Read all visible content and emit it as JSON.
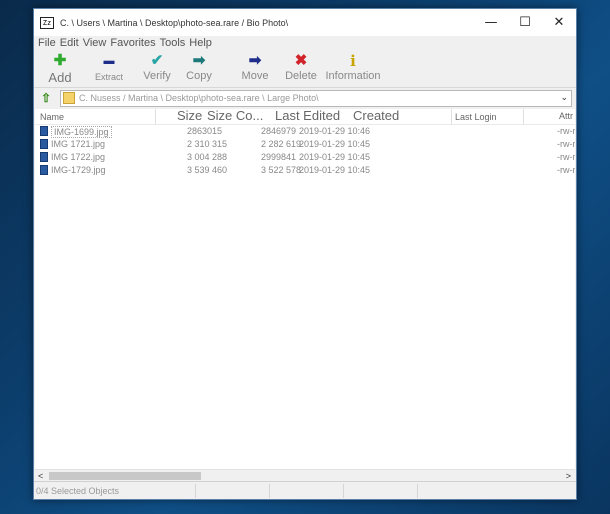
{
  "window": {
    "title": "C. \\ Users \\ Martina \\ Desktop\\photo-sea.rare / Bio Photo\\",
    "app_icon_text": "Zz",
    "controls": {
      "minimize": "—",
      "maximize": "☐",
      "close": "✕"
    }
  },
  "menu": [
    "File",
    "Edit",
    "View",
    "Favorites",
    "Tools",
    "Help"
  ],
  "toolbar": [
    {
      "label": "Add",
      "icon": "plus-icon",
      "glyph": "✚",
      "color": "#2eaa2e"
    },
    {
      "label": "Extract",
      "icon": "minus-icon",
      "glyph": "▬",
      "color": "#1f2d8a"
    },
    {
      "label": "Verify",
      "icon": "check-icon",
      "glyph": "✔",
      "color": "#2aa6a6"
    },
    {
      "label": "Copy",
      "icon": "copy-arrow-icon",
      "glyph": "➡",
      "color": "#1e7a7a"
    },
    {
      "label": "Move",
      "icon": "move-arrow-icon",
      "glyph": "➡",
      "color": "#1f2d8a"
    },
    {
      "label": "Delete",
      "icon": "delete-x-icon",
      "glyph": "✖",
      "color": "#d0242a"
    },
    {
      "label": "Information",
      "icon": "info-icon",
      "glyph": "i",
      "color": "#c9a400"
    }
  ],
  "address": {
    "path": "C. Nusess / Martina \\ Desktop\\photo-sea.rare \\ Large Photo\\",
    "dropdown_glyph": "⌄"
  },
  "columns": [
    "Name",
    "Size",
    "Size Co...",
    "Last Edited",
    "Created",
    "Last Login",
    "Attr"
  ],
  "files": [
    {
      "name": "IMG-1699.jpg",
      "size": "2863015",
      "packed": "2846979",
      "modified": "2019-01-29 10:46",
      "attr": "-rw-r"
    },
    {
      "name": "IMG 1721.jpg",
      "size": "2 310 315",
      "packed": "2 282 619",
      "modified": "2019-01-29 10:45",
      "attr": "-rw-r"
    },
    {
      "name": "IMG 1722.jpg",
      "size": "3 004 288",
      "packed": "2999841",
      "modified": "2019-01-29 10:45",
      "attr": "-rw-r"
    },
    {
      "name": "IMG-1729.jpg",
      "size": "3 539 460",
      "packed": "3 522 578",
      "modified": "2019-01-29 10:45",
      "attr": "-rw-r"
    }
  ],
  "scrollbar": {
    "left": "<",
    "right": ">"
  },
  "status": {
    "selected": "0/4 Selected Objects"
  },
  "colors": {
    "accent": "#2a5aa0",
    "folder": "#f3d36a"
  }
}
